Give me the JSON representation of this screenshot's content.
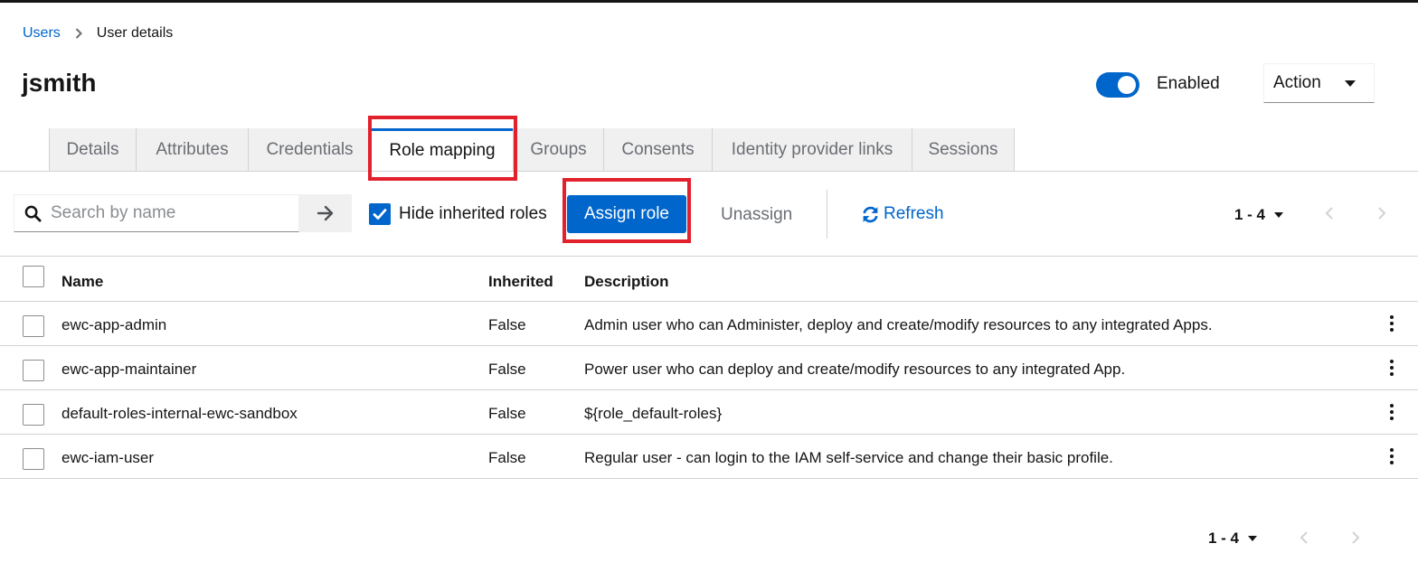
{
  "breadcrumb": {
    "parent": "Users",
    "current": "User details"
  },
  "page": {
    "title": "jsmith"
  },
  "header": {
    "enabled_label": "Enabled",
    "enabled": true,
    "action_label": "Action"
  },
  "tabs": [
    {
      "label": "Details"
    },
    {
      "label": "Attributes"
    },
    {
      "label": "Credentials"
    },
    {
      "label": "Role mapping",
      "active": true
    },
    {
      "label": "Groups"
    },
    {
      "label": "Consents"
    },
    {
      "label": "Identity provider links"
    },
    {
      "label": "Sessions"
    }
  ],
  "toolbar": {
    "search_placeholder": "Search by name",
    "hide_inherited_label": "Hide inherited roles",
    "hide_inherited_checked": true,
    "assign_label": "Assign role",
    "unassign_label": "Unassign",
    "refresh_label": "Refresh",
    "pagination": "1 - 4"
  },
  "table": {
    "headers": {
      "name": "Name",
      "inherited": "Inherited",
      "description": "Description"
    },
    "rows": [
      {
        "name": "ewc-app-admin",
        "inherited": "False",
        "description": "Admin user who can Administer, deploy and create/modify resources to any integrated Apps."
      },
      {
        "name": "ewc-app-maintainer",
        "inherited": "False",
        "description": "Power user who can deploy and create/modify resources to any integrated App."
      },
      {
        "name": "default-roles-internal-ewc-sandbox",
        "inherited": "False",
        "description": "${role_default-roles}"
      },
      {
        "name": "ewc-iam-user",
        "inherited": "False",
        "description": "Regular user - can login to the IAM self-service and change their basic profile."
      }
    ]
  },
  "footer": {
    "pagination": "1 - 4"
  },
  "colors": {
    "accent": "#0066cc",
    "highlight": "#e3212d"
  }
}
